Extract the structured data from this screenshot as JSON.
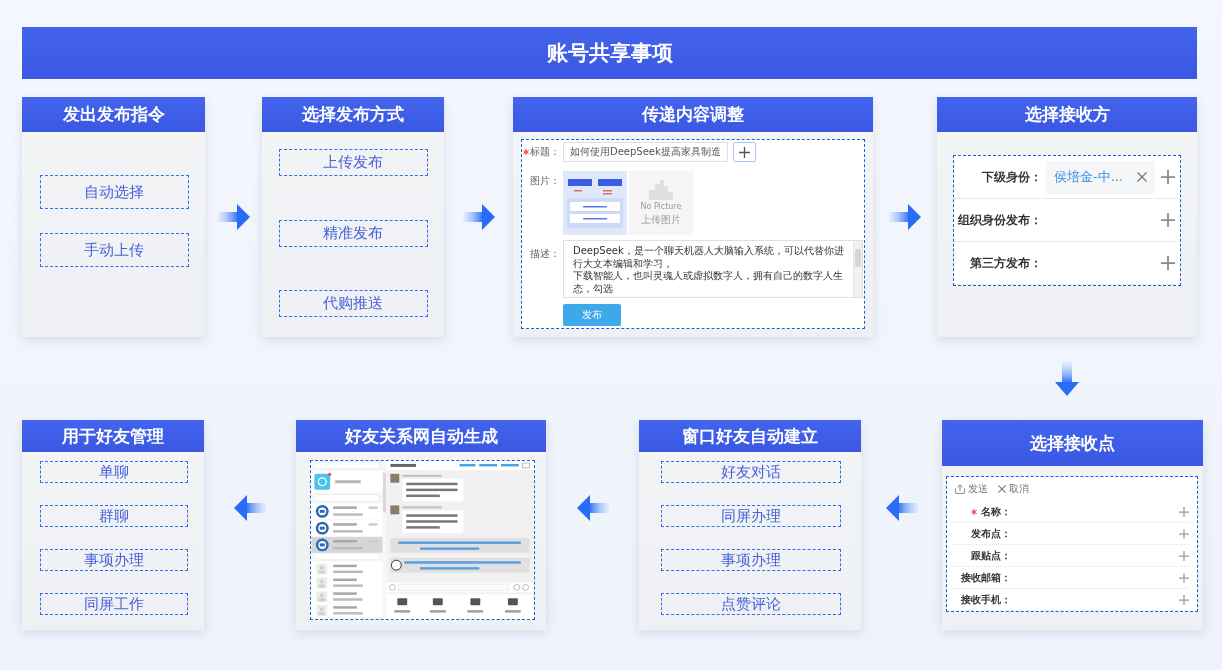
{
  "title": "账号共享事项",
  "top_row": [
    {
      "kind": "options",
      "title": "发出发布指令",
      "options": [
        "自动选择",
        "手动上传"
      ]
    },
    {
      "kind": "options",
      "title": "选择发布方式",
      "options": [
        "上传发布",
        "精准发布",
        "代购推送"
      ]
    },
    {
      "kind": "content_form",
      "title": "传递内容调整",
      "title_field": {
        "label": "标题：",
        "required": true,
        "value": "如何使用DeepSeek提高家具制造"
      },
      "image_field": {
        "label": "图片：",
        "empty_slot": {
          "caption": "No Picture",
          "action": "上传图片"
        }
      },
      "description_field": {
        "label": "描述：",
        "paragraphs": [
          "DeepSeek，是一个聊天机器人大脑输入系统，可以代替你进行大文本编辑和学习，",
          "下载智能人，也叫灵魂人或虚拟数字人，拥有自己的数字人生态，勾选"
        ]
      },
      "submit_button": "发布"
    },
    {
      "kind": "recipients",
      "title": "选择接收方",
      "rows": [
        {
          "label": "下级身份：",
          "tags": [
            "侯培金-中..."
          ]
        },
        {
          "label": "组织身份发布："
        },
        {
          "label": "第三方发布："
        }
      ]
    }
  ],
  "bottom_row": [
    {
      "kind": "options",
      "title": "用于好友管理",
      "options": [
        "单聊",
        "群聊",
        "事项办理",
        "同屏工作"
      ]
    },
    {
      "kind": "network",
      "title": "好友关系网自动生成"
    },
    {
      "kind": "options",
      "title": "窗口好友自动建立",
      "options": [
        "好友对话",
        "同屏办理",
        "事项办理",
        "点赞评论"
      ]
    },
    {
      "kind": "receive_points",
      "title": "选择接收点",
      "toolbar": [
        {
          "kind": "send",
          "label": "发送"
        },
        {
          "kind": "cancel",
          "label": "取消"
        }
      ],
      "rows": [
        {
          "label": "名称：",
          "required": true
        },
        {
          "label": "发布点：",
          "required": false
        },
        {
          "label": "跟贴点：",
          "required": false
        },
        {
          "label": "接收邮箱：",
          "required": false
        },
        {
          "label": "接收手机：",
          "required": false
        }
      ]
    }
  ]
}
